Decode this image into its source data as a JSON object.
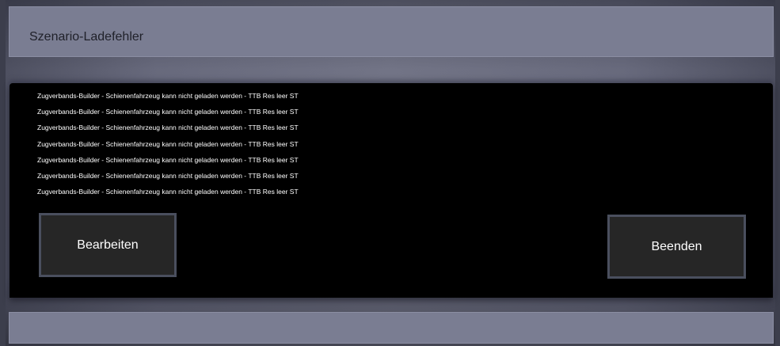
{
  "dialog": {
    "title": "Szenario-Ladefehler",
    "messages": [
      "Zugverbands-Builder - Schienenfahrzeug kann nicht geladen werden - TTB Res leer ST",
      "Zugverbands-Builder - Schienenfahrzeug kann nicht geladen werden - TTB Res leer ST",
      "Zugverbands-Builder - Schienenfahrzeug kann nicht geladen werden - TTB Res leer ST",
      "Zugverbands-Builder - Schienenfahrzeug kann nicht geladen werden - TTB Res leer ST",
      "Zugverbands-Builder - Schienenfahrzeug kann nicht geladen werden - TTB Res leer ST",
      "Zugverbands-Builder - Schienenfahrzeug kann nicht geladen werden - TTB Res leer ST",
      "Zugverbands-Builder - Schienenfahrzeug kann nicht geladen werden - TTB Res leer ST"
    ],
    "edit_label": "Bearbeiten",
    "quit_label": "Beenden"
  },
  "colors": {
    "panel_background": "#000000",
    "button_background": "#262626",
    "button_border": "#4a4f5e",
    "title_bar_background": "#7a7d92"
  }
}
